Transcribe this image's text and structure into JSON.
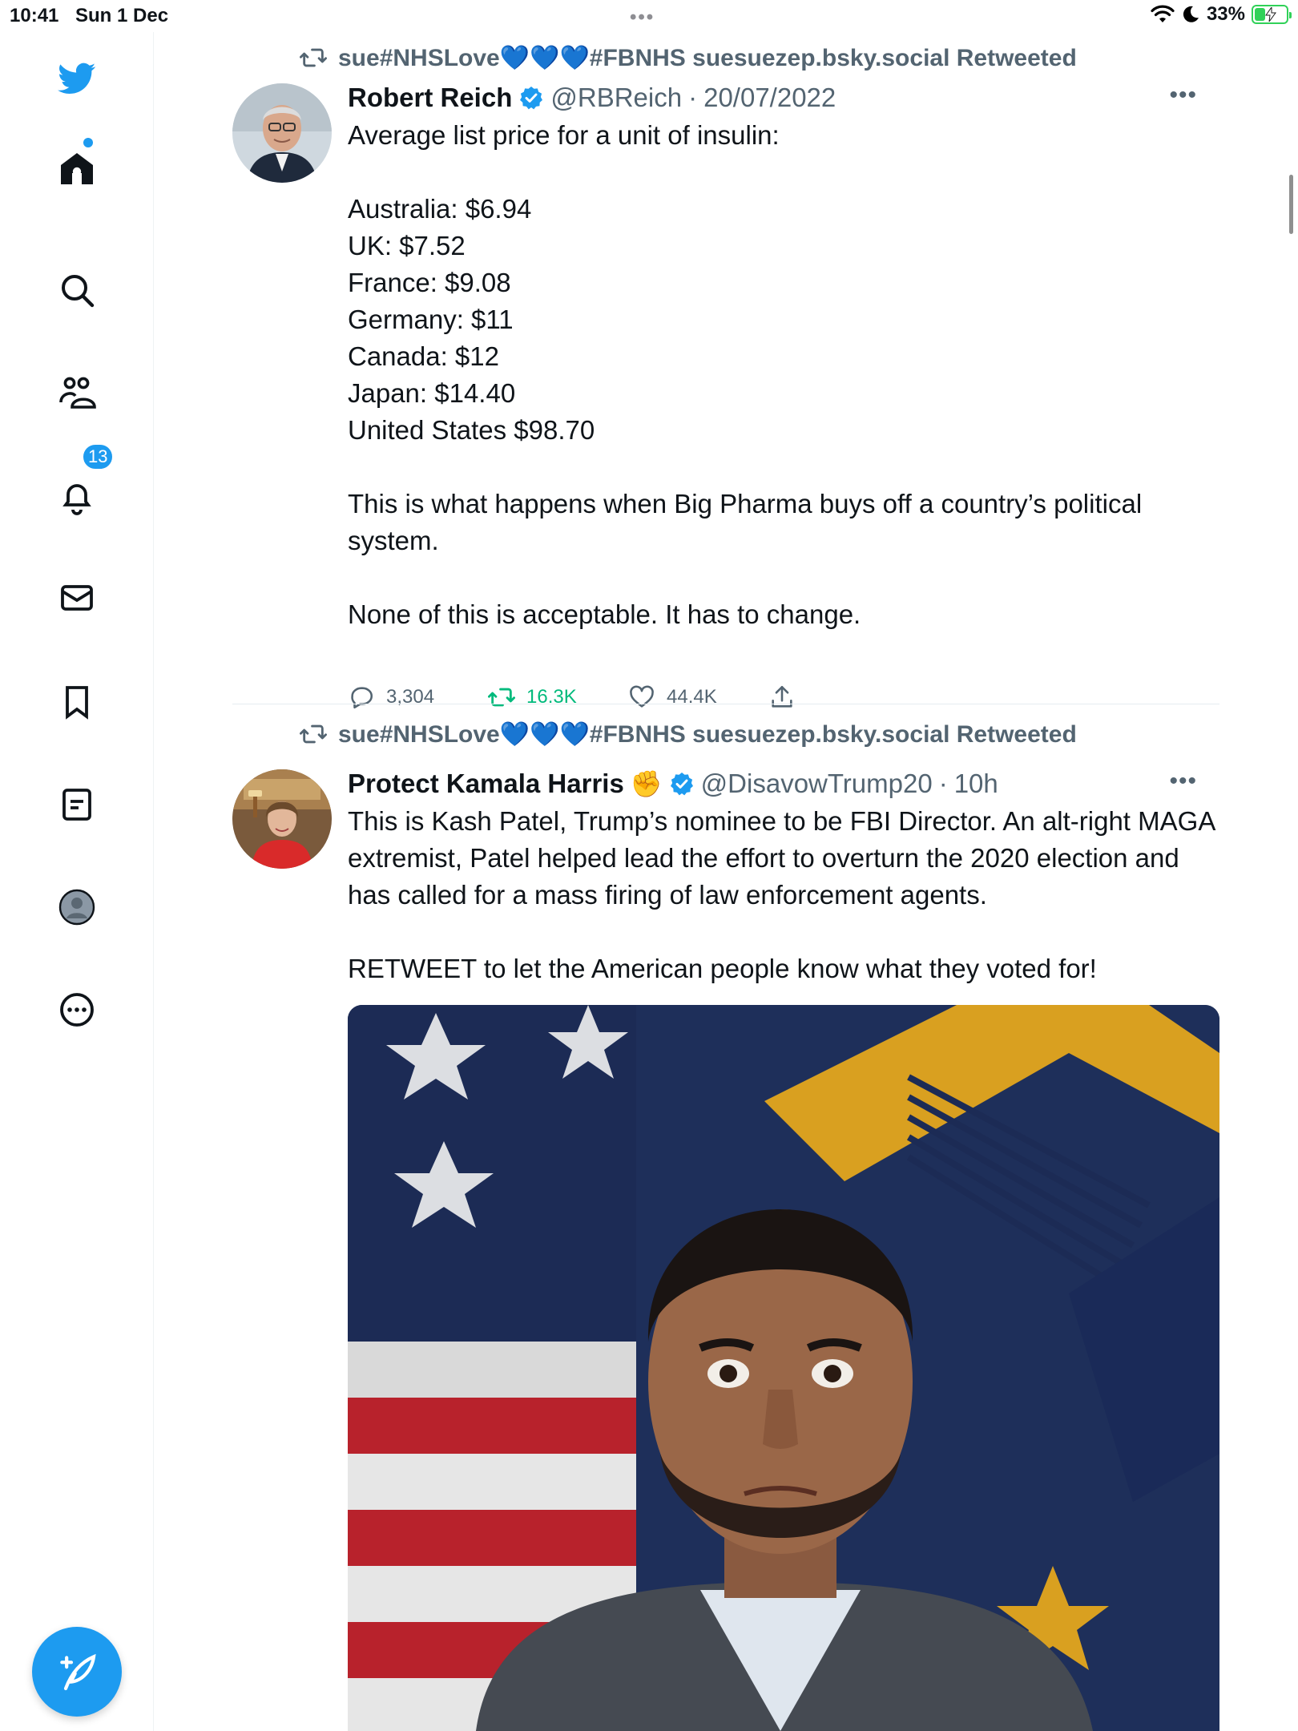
{
  "status_bar": {
    "time": "10:41",
    "date": "Sun 1 Dec",
    "battery_text": "33%",
    "battery_level": 0.33
  },
  "sidebar": {
    "items": [
      {
        "icon": "twitter-logo-icon"
      },
      {
        "icon": "home-icon"
      },
      {
        "icon": "search-icon"
      },
      {
        "icon": "communities-icon"
      },
      {
        "icon": "notifications-icon",
        "badge": "13"
      },
      {
        "icon": "messages-icon"
      },
      {
        "icon": "bookmarks-icon"
      },
      {
        "icon": "lists-icon"
      },
      {
        "icon": "profile-icon"
      },
      {
        "icon": "more-icon"
      }
    ],
    "compose_icon": "compose-tweet-icon"
  },
  "colors": {
    "accent": "#1d9bf0",
    "retweet_green": "#00ba7c",
    "secondary_text": "#536471"
  },
  "feed": {
    "tweets": [
      {
        "retweeted_by": "sue#NHSLove💙💙💙#FBNHS suesuezep.bsky.social Retweeted",
        "name": "Robert Reich",
        "handle": "@RBReich",
        "sep": "·",
        "time": "20/07/2022",
        "lines": [
          "Average list price for a unit of insulin:",
          "",
          "Australia: $6.94",
          "UK: $7.52",
          "France: $9.08",
          "Germany: $11",
          "Canada: $12",
          "Japan: $14.40",
          "United States $98.70",
          "",
          "This is what happens when Big Pharma buys off a country’s political system.",
          "",
          "None of this is acceptable. It has to change."
        ],
        "replies": "3,304",
        "retweets": "16.3K",
        "likes": "44.4K"
      },
      {
        "retweeted_by": "sue#NHSLove💙💙💙#FBNHS suesuezep.bsky.social Retweeted",
        "name": "Protect Kamala Harris",
        "name_emoji": "✊",
        "handle": "@DisavowTrump20",
        "sep": "·",
        "time": "10h",
        "lines": [
          "This is Kash Patel, Trump’s nominee to be FBI Director. An alt-right MAGA extremist, Patel helped lead the effort to overturn the 2020 election and has called for a mass firing of law enforcement agents.",
          "",
          "RETWEET to let the American people know what they voted for!"
        ]
      }
    ]
  }
}
